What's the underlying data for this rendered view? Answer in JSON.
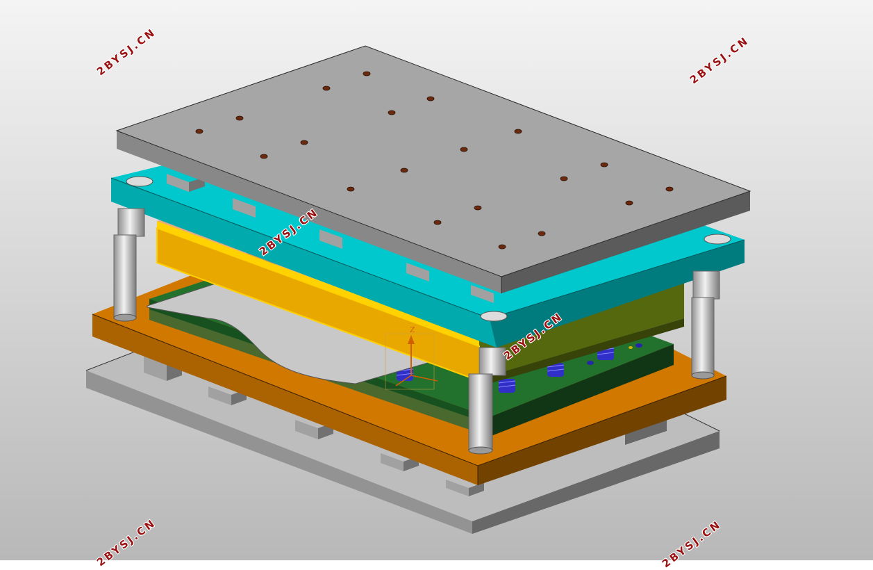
{
  "watermark": {
    "text": "2BYSJ.CN",
    "color": "#9b1010"
  },
  "colors": {
    "background_top": "#f4f4f4",
    "background_bottom": "#b8b8b8",
    "top_plate": "#a6a6a6",
    "upper_die_plate": "#00c8cc",
    "punch_plate": "#e8a800",
    "stripper_plate": "#3d4a0a",
    "lower_die_plate": "#1b5a24",
    "lower_die_shoe": "#d07800",
    "base_plate": "#bdbdbd",
    "guide_pillar": "#cfcfcf",
    "spring": "#3030c8",
    "sheet_blank": "#c8c8c8"
  },
  "labels": {
    "axis_z": "Z"
  }
}
